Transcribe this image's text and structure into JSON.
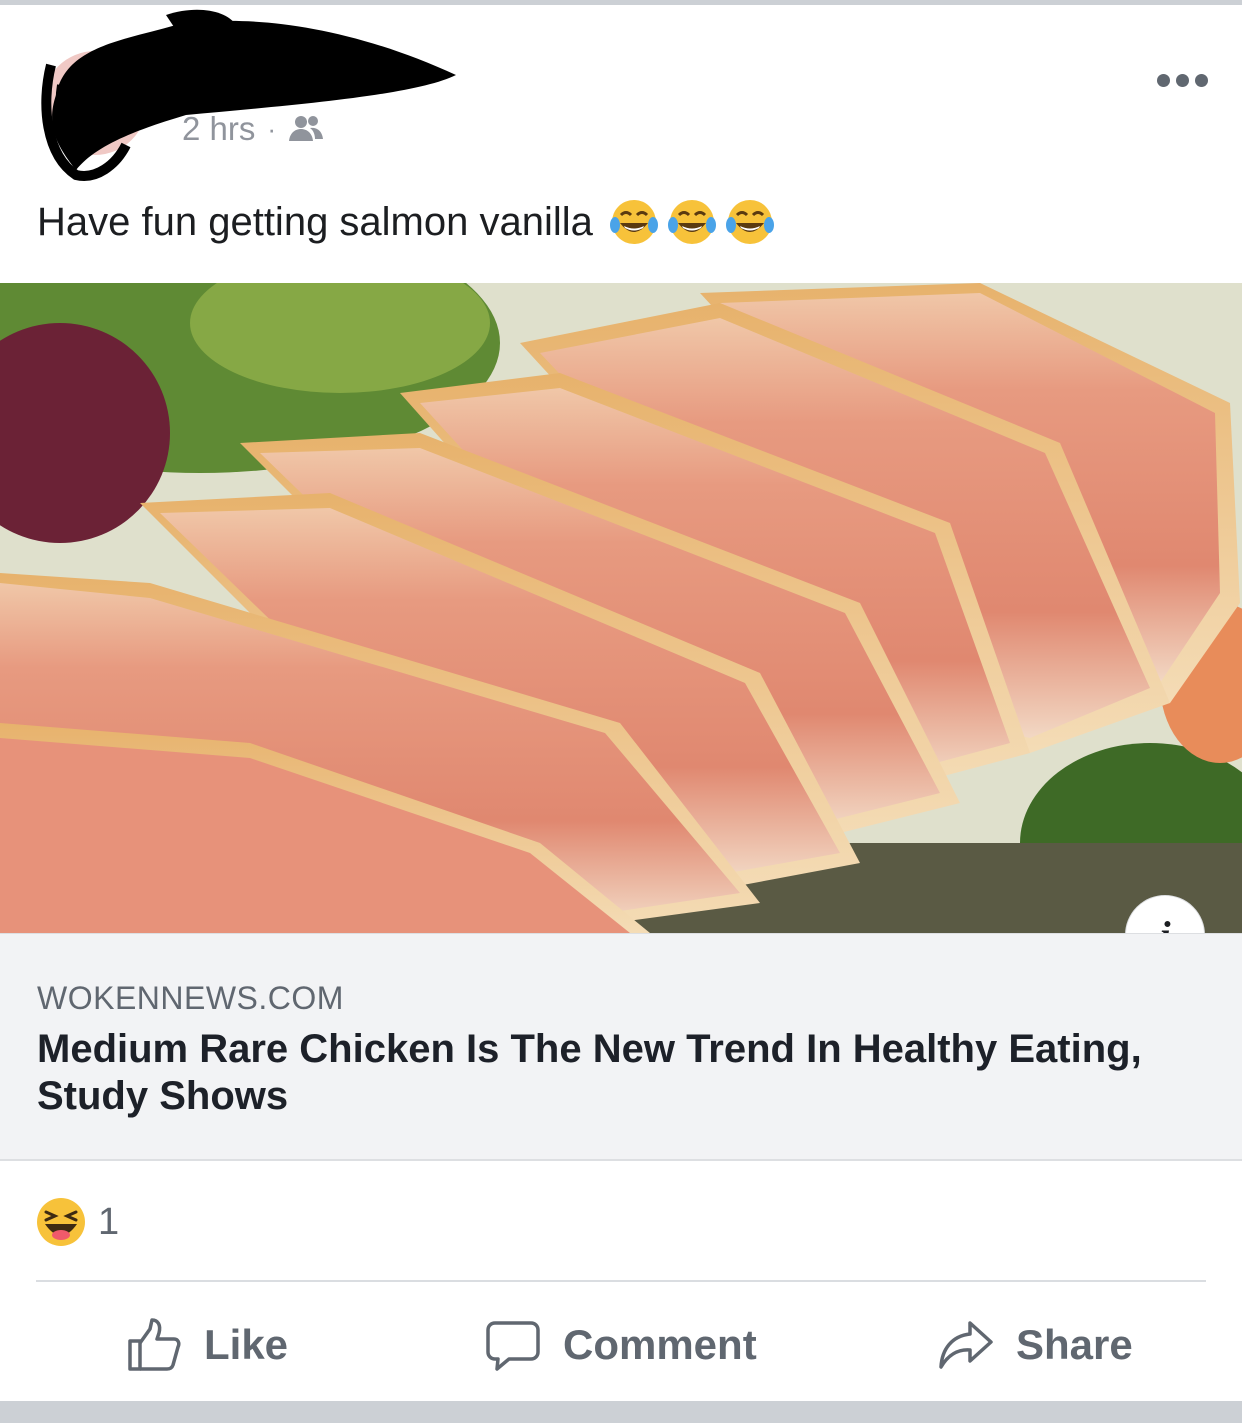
{
  "post": {
    "timestamp": "2 hrs",
    "separator": "·",
    "audience_icon": "friends-icon",
    "more_icon": "more-options-icon",
    "text": "Have fun getting salmon vanilla",
    "emojis": [
      "face-with-tears-of-joy",
      "face-with-tears-of-joy",
      "face-with-tears-of-joy"
    ]
  },
  "link": {
    "image_description_icon": "sliced-seared-chicken-image",
    "info_label": "i",
    "domain": "WOKENNEWS.COM",
    "title": "Medium Rare Chicken Is The New Trend In Healthy Eating, Study Shows"
  },
  "reactions": {
    "icon": "haha-reaction-icon",
    "count": "1"
  },
  "actions": {
    "like_label": "Like",
    "comment_label": "Comment",
    "share_label": "Share"
  },
  "colors": {
    "meta_text": "#90949c",
    "action_text": "#606770",
    "caption_bg": "#f2f3f5",
    "title_text": "#1d2129"
  }
}
